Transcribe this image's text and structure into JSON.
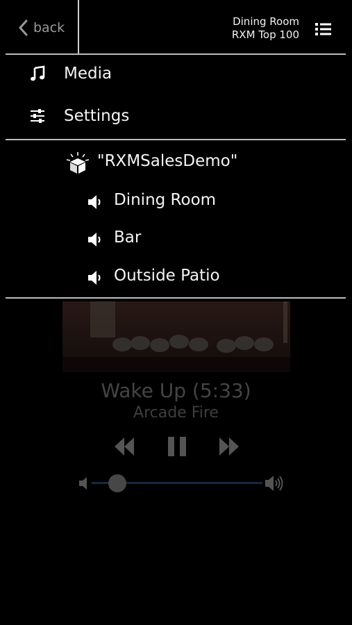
{
  "header": {
    "back_label": "back",
    "zone_name": "Dining Room",
    "source_name": "RXM Top 100"
  },
  "menu": [
    {
      "label": "Media",
      "icon": "music-note-icon"
    },
    {
      "label": "Settings",
      "icon": "sliders-icon"
    }
  ],
  "system": {
    "label": "\"RXMSalesDemo\"",
    "icon": "system-box-icon"
  },
  "zones": [
    {
      "label": "Dining Room",
      "icon": "speaker-icon"
    },
    {
      "label": "Bar",
      "icon": "speaker-icon"
    },
    {
      "label": "Outside Patio",
      "icon": "speaker-icon"
    }
  ],
  "player": {
    "title": "Wake Up (5:33)",
    "artist": "Arcade Fire",
    "volume_fraction": 0.15,
    "accent_color": "#3b7fc9"
  }
}
